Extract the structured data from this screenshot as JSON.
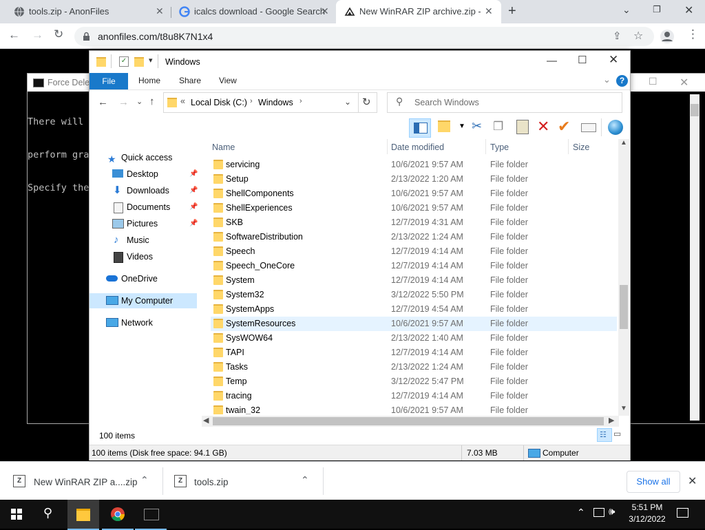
{
  "browser": {
    "tabs": [
      {
        "title": "tools.zip - AnonFiles",
        "active": false
      },
      {
        "title": "icalcs download - Google Search",
        "active": false
      },
      {
        "title": "New WinRAR ZIP archive.zip - Ar",
        "active": true
      }
    ],
    "url": "anonfiles.com/t8u8K7N1x4"
  },
  "console": {
    "title": "Force Delete",
    "lines": [
      "There will b",
      "perform gra",
      "Specify the"
    ]
  },
  "explorer": {
    "title": "Windows",
    "ribbon": {
      "file": "File",
      "home": "Home",
      "share": "Share",
      "view": "View"
    },
    "breadcrumb": {
      "prefix": "«",
      "part1": "Local Disk (C:)",
      "part2": "Windows"
    },
    "search_placeholder": "Search Windows",
    "nav": {
      "quick_access": "Quick access",
      "desktop": "Desktop",
      "downloads": "Downloads",
      "documents": "Documents",
      "pictures": "Pictures",
      "music": "Music",
      "videos": "Videos",
      "onedrive": "OneDrive",
      "my_computer": "My Computer",
      "network": "Network"
    },
    "columns": {
      "name": "Name",
      "date": "Date modified",
      "type": "Type",
      "size": "Size"
    },
    "rows": [
      {
        "name": "servicing",
        "date": "10/6/2021 9:57 AM",
        "type": "File folder"
      },
      {
        "name": "Setup",
        "date": "2/13/2022 1:20 AM",
        "type": "File folder"
      },
      {
        "name": "ShellComponents",
        "date": "10/6/2021 9:57 AM",
        "type": "File folder"
      },
      {
        "name": "ShellExperiences",
        "date": "10/6/2021 9:57 AM",
        "type": "File folder"
      },
      {
        "name": "SKB",
        "date": "12/7/2019 4:31 AM",
        "type": "File folder"
      },
      {
        "name": "SoftwareDistribution",
        "date": "2/13/2022 1:24 AM",
        "type": "File folder"
      },
      {
        "name": "Speech",
        "date": "12/7/2019 4:14 AM",
        "type": "File folder"
      },
      {
        "name": "Speech_OneCore",
        "date": "12/7/2019 4:14 AM",
        "type": "File folder"
      },
      {
        "name": "System",
        "date": "12/7/2019 4:14 AM",
        "type": "File folder"
      },
      {
        "name": "System32",
        "date": "3/12/2022 5:50 PM",
        "type": "File folder"
      },
      {
        "name": "SystemApps",
        "date": "12/7/2019 4:54 AM",
        "type": "File folder"
      },
      {
        "name": "SystemResources",
        "date": "10/6/2021 9:57 AM",
        "type": "File folder"
      },
      {
        "name": "SysWOW64",
        "date": "2/13/2022 1:40 AM",
        "type": "File folder"
      },
      {
        "name": "TAPI",
        "date": "12/7/2019 4:14 AM",
        "type": "File folder"
      },
      {
        "name": "Tasks",
        "date": "2/13/2022 1:24 AM",
        "type": "File folder"
      },
      {
        "name": "Temp",
        "date": "3/12/2022 5:47 PM",
        "type": "File folder"
      },
      {
        "name": "tracing",
        "date": "12/7/2019 4:14 AM",
        "type": "File folder"
      },
      {
        "name": "twain_32",
        "date": "10/6/2021 9:57 AM",
        "type": "File folder"
      }
    ],
    "item_count": "100 items",
    "status": {
      "left": "100 items (Disk free space: 94.1 GB)",
      "size": "7.03 MB",
      "location": "Computer"
    }
  },
  "downloads": {
    "items": [
      {
        "name": "New WinRAR ZIP a....zip"
      },
      {
        "name": "tools.zip"
      }
    ],
    "show_all": "Show all"
  },
  "taskbar": {
    "time": "5:51 PM",
    "date": "3/12/2022"
  }
}
